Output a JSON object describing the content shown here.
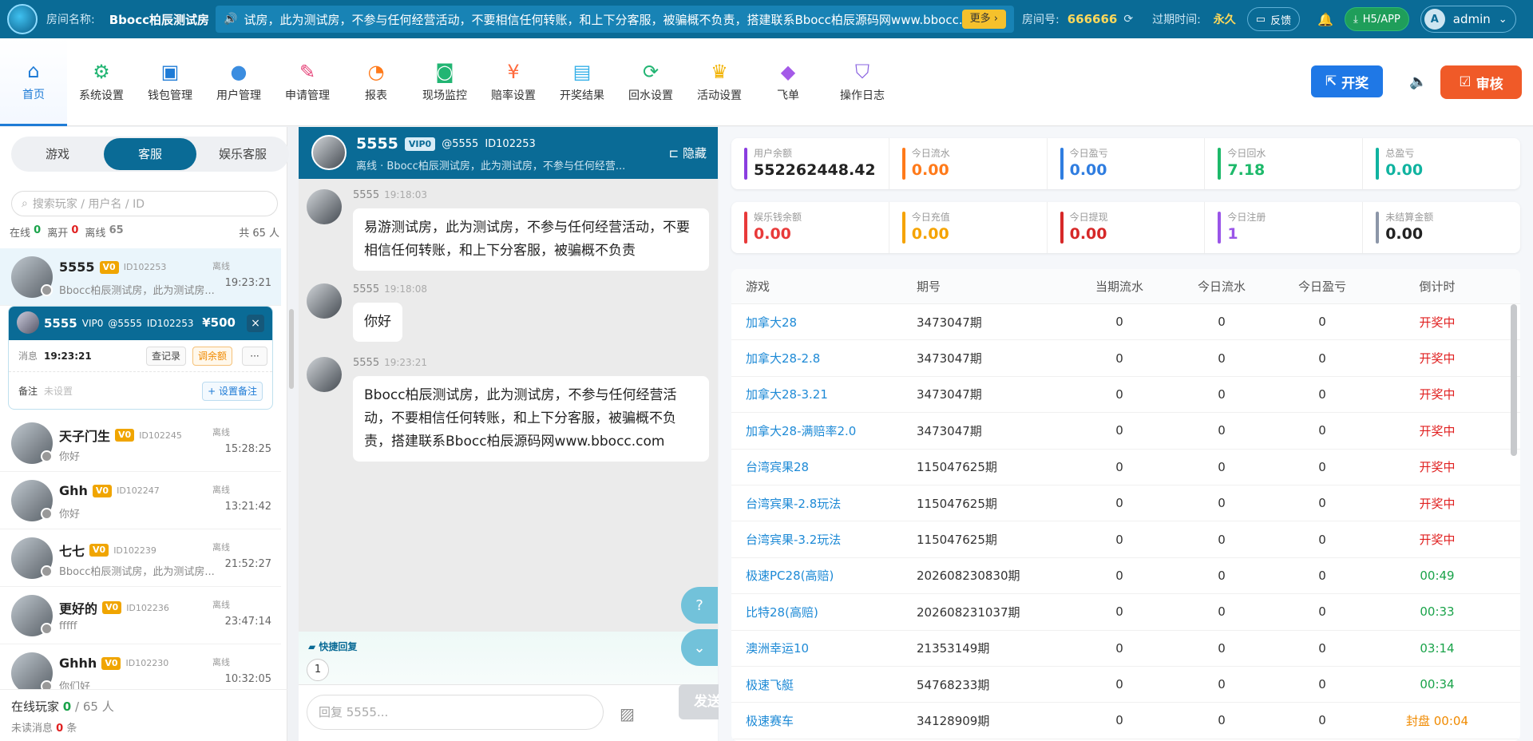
{
  "topbar": {
    "room_label": "房间名称:",
    "room_name": "Bbocc柏辰测试房",
    "notice": "试房，此为测试房，不参与任何经营活动，不要相信任何转账，和上下分客服，被骗概不负责，搭建联系Bbocc柏辰源码网www.bbocc.cc",
    "more": "更多 ›",
    "room_no_label": "房间号:",
    "room_no": "666666",
    "expire_label": "过期时间:",
    "expire": "永久",
    "feedback": "反馈",
    "h5app": "H5/APP",
    "user": "admin",
    "user_initial": "A"
  },
  "nav": {
    "items": [
      {
        "label": "首页",
        "icon": "home-icon",
        "color": "#1e7bd6"
      },
      {
        "label": "系统设置",
        "icon": "gear-icon",
        "color": "#22b573"
      },
      {
        "label": "钱包管理",
        "icon": "wallet-icon",
        "color": "#1e7bd6"
      },
      {
        "label": "用户管理",
        "icon": "user-icon",
        "color": "#3b8de0"
      },
      {
        "label": "申请管理",
        "icon": "form-icon",
        "color": "#e6457a"
      },
      {
        "label": "报表",
        "icon": "pie-icon",
        "color": "#ff7a1a"
      },
      {
        "label": "现场监控",
        "icon": "camera-icon",
        "color": "#22b573"
      },
      {
        "label": "赔率设置",
        "icon": "odds-icon",
        "color": "#ff6a3d"
      },
      {
        "label": "开奖结果",
        "icon": "result-icon",
        "color": "#35b0e8"
      },
      {
        "label": "回水设置",
        "icon": "refresh-icon",
        "color": "#22b573"
      },
      {
        "label": "活动设置",
        "icon": "trophy-icon",
        "color": "#f2b200"
      },
      {
        "label": "飞单",
        "icon": "apps-icon",
        "color": "#a45ae8"
      },
      {
        "label": "操作日志",
        "icon": "shield-icon",
        "color": "#8a63e0"
      }
    ],
    "kai": "开奖",
    "shen": "审核"
  },
  "left": {
    "tabs": [
      "游戏",
      "客服",
      "娱乐客服"
    ],
    "search_placeholder": "搜索玩家 / 用户名 / ID",
    "stats": {
      "online_label": "在线",
      "online": "0",
      "away_label": "离开",
      "away": "0",
      "offline_label": "离线",
      "offline": "65",
      "total": "共 65 人"
    },
    "items": [
      {
        "name": "5555",
        "vip": "V0",
        "id": "ID102253",
        "status": "离线",
        "time": "19:23:21",
        "msg": "Bbocc柏辰测试房，此为测试房..."
      },
      {
        "name": "天子门生",
        "vip": "V0",
        "id": "ID102245",
        "status": "离线",
        "time": "15:28:25",
        "msg": "你好"
      },
      {
        "name": "Ghh",
        "vip": "V0",
        "id": "ID102247",
        "status": "离线",
        "time": "13:21:42",
        "msg": "你好"
      },
      {
        "name": "七七",
        "vip": "V0",
        "id": "ID102239",
        "status": "离线",
        "time": "21:52:27",
        "msg": "Bbocc柏辰测试房，此为测试房..."
      },
      {
        "name": "更好的",
        "vip": "V0",
        "id": "ID102236",
        "status": "离线",
        "time": "23:47:14",
        "msg": "fffff"
      },
      {
        "name": "Ghhh",
        "vip": "V0",
        "id": "ID102230",
        "status": "离线",
        "time": "10:32:05",
        "msg": "你们好"
      }
    ],
    "popup": {
      "name": "5555",
      "vip": "VIP0",
      "handle": "@5555",
      "id": "ID102253",
      "money": "¥500",
      "close": "×",
      "msg_label": "消息",
      "msg_time": "19:23:21",
      "btn_record": "查记录",
      "btn_adjust": "调余额",
      "btn_more": "···",
      "note_label": "备注",
      "note_value": "未设置",
      "set_note": "+ 设置备注"
    },
    "footer": {
      "online_label": "在线玩家",
      "online": "0",
      "total": "/ 65 人",
      "unread_label": "未读消息",
      "unread": "0",
      "unread_unit": "条"
    }
  },
  "chat": {
    "name": "5555",
    "vip": "VIP0",
    "handle": "@5555",
    "id": "ID102253",
    "status": "离线 · Bbocc柏辰测试房，此为测试房，不参与任何经营...",
    "hide": "隐藏",
    "messages": [
      {
        "sender": "5555",
        "time": "19:18:03",
        "text": "易游测试房，此为测试房，不参与任何经营活动，不要相信任何转账，和上下分客服，被骗概不负责"
      },
      {
        "sender": "5555",
        "time": "19:18:08",
        "text": "你好"
      },
      {
        "sender": "5555",
        "time": "19:23:21",
        "text": "Bbocc柏辰测试房，此为测试房，不参与任何经营活动，不要相信任何转账，和上下分客服，被骗概不负责，搭建联系Bbocc柏辰源码网www.bbocc.com"
      }
    ],
    "quick_reply": "快捷回复",
    "quick_num": "1",
    "input_placeholder": "回复 5555...",
    "send": "发送"
  },
  "stats": [
    {
      "label": "用户余额",
      "value": "552262448.42",
      "color": "#8a3ee0",
      "vcolor": "#222"
    },
    {
      "label": "今日流水",
      "value": "0.00",
      "color": "#ff7a1a",
      "vcolor": "#ff7a1a"
    },
    {
      "label": "今日盈亏",
      "value": "0.00",
      "color": "#2f7de0",
      "vcolor": "#2f7de0"
    },
    {
      "label": "今日回水",
      "value": "7.18",
      "color": "#1db96a",
      "vcolor": "#1db96a"
    },
    {
      "label": "总盈亏",
      "value": "0.00",
      "color": "#10b3a0",
      "vcolor": "#10b3a0"
    },
    {
      "label": "娱乐钱余额",
      "value": "0.00",
      "color": "#e83a3a",
      "vcolor": "#e83a3a"
    },
    {
      "label": "今日充值",
      "value": "0.00",
      "color": "#f5a300",
      "vcolor": "#f5a300"
    },
    {
      "label": "今日提现",
      "value": "0.00",
      "color": "#d62828",
      "vcolor": "#d62828"
    },
    {
      "label": "今日注册",
      "value": "1",
      "color": "#9a55e8",
      "vcolor": "#9a55e8"
    },
    {
      "label": "未结算金额",
      "value": "0.00",
      "color": "#8c96a8",
      "vcolor": "#222"
    }
  ],
  "table": {
    "headers": [
      "游戏",
      "期号",
      "当期流水",
      "今日流水",
      "今日盈亏",
      "倒计时"
    ],
    "rows": [
      [
        "加拿大28",
        "3473047期",
        "0",
        "0",
        "0",
        "开奖中"
      ],
      [
        "加拿大28-2.8",
        "3473047期",
        "0",
        "0",
        "0",
        "开奖中"
      ],
      [
        "加拿大28-3.21",
        "3473047期",
        "0",
        "0",
        "0",
        "开奖中"
      ],
      [
        "加拿大28-满赔率2.0",
        "3473047期",
        "0",
        "0",
        "0",
        "开奖中"
      ],
      [
        "台湾宾果28",
        "115047625期",
        "0",
        "0",
        "0",
        "开奖中"
      ],
      [
        "台湾宾果-2.8玩法",
        "115047625期",
        "0",
        "0",
        "0",
        "开奖中"
      ],
      [
        "台湾宾果-3.2玩法",
        "115047625期",
        "0",
        "0",
        "0",
        "开奖中"
      ],
      [
        "极速PC28(高赔)",
        "202608230830期",
        "0",
        "0",
        "0",
        "00:49"
      ],
      [
        "比特28(高赔)",
        "202608231037期",
        "0",
        "0",
        "0",
        "00:33"
      ],
      [
        "澳洲幸运10",
        "21353149期",
        "0",
        "0",
        "0",
        "03:14"
      ],
      [
        "极速飞艇",
        "54768233期",
        "0",
        "0",
        "0",
        "00:34"
      ],
      [
        "极速赛车",
        "34128909期",
        "0",
        "0",
        "0",
        "封盘 00:04"
      ]
    ],
    "countdown_colors": [
      "#e02020",
      "#e02020",
      "#e02020",
      "#e02020",
      "#e02020",
      "#e02020",
      "#e02020",
      "#1aa34a",
      "#1aa34a",
      "#1aa34a",
      "#1aa34a",
      "#f08a00"
    ]
  }
}
